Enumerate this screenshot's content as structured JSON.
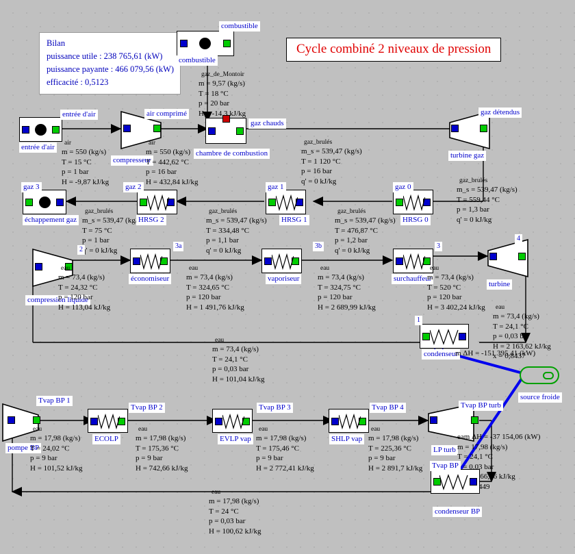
{
  "title": "Cycle combiné 2 niveaux de pression",
  "bilan": {
    "heading": "Bilan",
    "line1": "puissance  utile : 238 765,61 (kW)",
    "line2": "puissance payante : 466 079,56 (kW)",
    "line3": "efficacité : 0,5123"
  },
  "tags": {
    "combustible_top": "combustible",
    "combustible_unit": "combustible",
    "entree_air_stream": "entrée d'air",
    "entree_air_unit": "entrée d'air",
    "air_comprime": "air comprimé",
    "compresseur": "compresseur",
    "chambre": "chambre de combustion",
    "gaz_chauds": "gaz chauds",
    "gaz_detendus": "gaz détendus",
    "turbine_gaz": "turbine gaz",
    "gaz3": "gaz 3",
    "echappement": "échappement gaz",
    "gaz2": "gaz 2",
    "hrsg2": "HRSG 2",
    "gaz1": "gaz 1",
    "hrsg1": "HRSG 1",
    "gaz0": "gaz 0",
    "hrsg0": "HRSG 0",
    "n2": "2",
    "compression_liquide": "compression liquide",
    "n3a": "3a",
    "economiseur": "économiseur",
    "n3b": "3b",
    "vaporiseur": "vaporiseur",
    "n3": "3",
    "surchauffeur": "surchauffeur",
    "n4": "4",
    "turbine": "turbine",
    "n1": "1",
    "condenseur": "condenseur",
    "source_froide": "source froide",
    "tvap_bp1": "Tvap BP 1",
    "pompe_bp": "pompe BP",
    "tvap_bp2": "Tvap BP 2",
    "ecolp": "ECOLP",
    "tvap_bp3": "Tvap BP 3",
    "evlp_vap": "EVLP vap",
    "tvap_bp4": "Tvap BP 4",
    "shlp_vap": "SHLP vap",
    "tvap_bp_turb": "Tvap BP turb",
    "lp_turb": "LP turb",
    "tvap_bp": "Tvap BP",
    "condenseur_bp": "condenseur BP"
  },
  "streams": {
    "gaz_de_montoir": {
      "name": "gaz_de_Montoir",
      "l1": "m = 9,57 (kg/s)",
      "l2": "T = 18 °C",
      "l3": "p = 20 bar",
      "l4": "H = -14,3 kJ/kg"
    },
    "air_in": {
      "name": "air",
      "l1": "m = 550 (kg/s)",
      "l2": "T = 15 °C",
      "l3": "p = 1 bar",
      "l4": "H = -9,87 kJ/kg"
    },
    "air_comp": {
      "name": "air",
      "l1": "m = 550 (kg/s)",
      "l2": "T = 442,62 °C",
      "l3": "p = 16 bar",
      "l4": "H = 432,84 kJ/kg"
    },
    "gaz_brules_hot": {
      "name": "gaz_brulés",
      "l1": "m_s = 539,47 (kg/s)",
      "l2": "T = 1 120 °C",
      "l3": "p = 16 bar",
      "l4": "q' = 0 kJ/kg"
    },
    "gaz_brules_exp": {
      "name": "gaz_brulés",
      "l1": "m_s = 539,47 (kg/s)",
      "l2": "T = 559,44 °C",
      "l3": "p = 1,3 bar",
      "l4": "q' = 0 kJ/kg"
    },
    "gaz_brules_ex": {
      "name": "gaz_brulés",
      "l1": "m_s = 539,47 (kg/s)",
      "l2": "T = 75 °C",
      "l3": "p = 1 bar",
      "l4": "q' = 0 kJ/kg"
    },
    "gaz_brules_2": {
      "name": "gaz_brulés",
      "l1": "m_s = 539,47 (kg/s)",
      "l2": "T = 334,48 °C",
      "l3": "p = 1,1 bar",
      "l4": "q' = 0 kJ/kg"
    },
    "gaz_brules_1": {
      "name": "gaz_brulés",
      "l1": "m_s = 539,47 (kg/s)",
      "l2": "T = 476,87 °C",
      "l3": "p = 1,2 bar",
      "l4": "q' = 0 kJ/kg"
    },
    "eau_2": {
      "name": "eau",
      "l1": "m = 73,4 (kg/s)",
      "l2": "T = 24,32 °C",
      "l3": "p = 120 bar",
      "l4": "H = 113,04 kJ/kg"
    },
    "eau_3a": {
      "name": "eau",
      "l1": "m = 73,4 (kg/s)",
      "l2": "T = 324,65 °C",
      "l3": "p = 120 bar",
      "l4": "H = 1 491,76 kJ/kg"
    },
    "eau_3b": {
      "name": "eau",
      "l1": "m = 73,4 (kg/s)",
      "l2": "T = 324,75 °C",
      "l3": "p = 120 bar",
      "l4": "H = 2 689,99 kJ/kg"
    },
    "eau_3": {
      "name": "eau",
      "l1": "m = 73,4 (kg/s)",
      "l2": "T = 520 °C",
      "l3": "p = 120 bar",
      "l4": "H = 3 402,24 kJ/kg"
    },
    "eau_4": {
      "name": "eau",
      "l1": "m = 73,4 (kg/s)",
      "l2": "T = 24,1 °C",
      "l3": "p = 0,03 bar",
      "l4": "H = 2 163,62 kJ/kg",
      "l5": "x = 0,8437"
    },
    "cond_duty": "m ΔH = -151 395,41 (kW)",
    "eau_1": {
      "name": "eau",
      "l1": "m = 73,4 (kg/s)",
      "l2": "T = 24,1 °C",
      "l3": "p = 0,03 bar",
      "l4": "H = 101,04 kJ/kg"
    },
    "eau_bp1": {
      "name": "eau",
      "l1": "m = 17,98 (kg/s)",
      "l2": "T = 24,02 °C",
      "l3": "p = 9 bar",
      "l4": "H = 101,52 kJ/kg"
    },
    "eau_bp2": {
      "name": "eau",
      "l1": "m = 17,98 (kg/s)",
      "l2": "T = 175,36 °C",
      "l3": "p = 9 bar",
      "l4": "H = 742,66 kJ/kg"
    },
    "eau_bp3": {
      "name": "eau",
      "l1": "m = 17,98 (kg/s)",
      "l2": "T = 175,46 °C",
      "l3": "p = 9 bar",
      "l4": "H = 2 772,41 kJ/kg"
    },
    "eau_bp4": {
      "name": "eau",
      "l1": "m = 17,98 (kg/s)",
      "l2": "T = 225,36 °C",
      "l3": "p = 9 bar",
      "l4": "H = 2 891,7 kJ/kg"
    },
    "eau_bp_turb": {
      "duty": "eam ΔH = -37 154,06 (kW)",
      "l1": "m = 17,98 (kg/s)",
      "l2": "T = 24,1 °C",
      "l3": "p = 0,03 bar",
      "l4": "H = 2 166,46 kJ/kg",
      "l5": "x = 0,8449"
    },
    "eau_bp_out": {
      "name": "eau",
      "l1": "m = 17,98 (kg/s)",
      "l2": "T = 24 °C",
      "l3": "p = 0,03 bar",
      "l4": "H = 100,62 kJ/kg"
    }
  },
  "colors": {
    "background": "#c0c0c0",
    "label_blue": "#0000cc",
    "title_red": "#e00000",
    "port_in": "#0000cc",
    "port_out": "#00cc00",
    "port_heat": "#cc0000",
    "cold_source": "#0000ee",
    "wire": "#000000"
  }
}
